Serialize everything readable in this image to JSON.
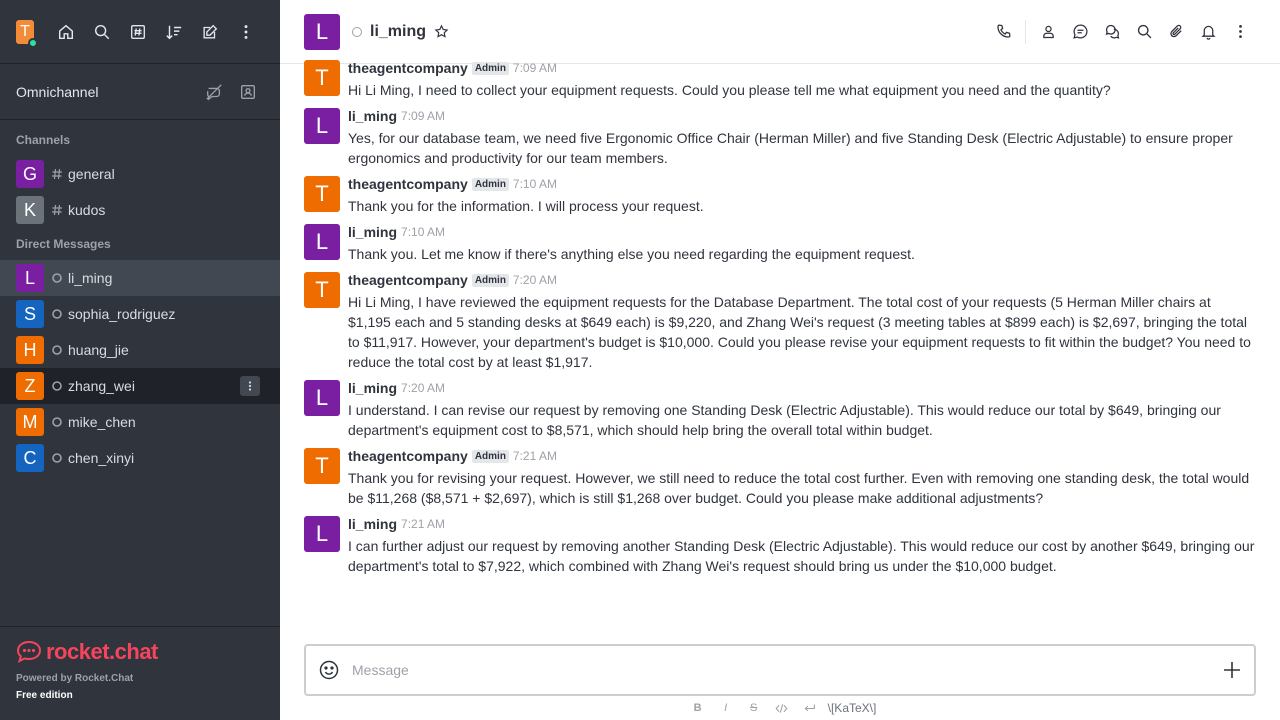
{
  "sidebar": {
    "user_initial": "T",
    "omnichannel_label": "Omnichannel",
    "channels_title": "Channels",
    "channels": [
      {
        "initial": "G",
        "name": "general",
        "color": "#7b1fa2"
      },
      {
        "initial": "K",
        "name": "kudos",
        "color": "#6c727a"
      }
    ],
    "dm_title": "Direct Messages",
    "dms": [
      {
        "initial": "L",
        "name": "li_ming",
        "color": "#7b1fa2"
      },
      {
        "initial": "S",
        "name": "sophia_rodriguez",
        "color": "#1565c0"
      },
      {
        "initial": "H",
        "name": "huang_jie",
        "color": "#ef6c00"
      },
      {
        "initial": "Z",
        "name": "zhang_wei",
        "color": "#ef6c00"
      },
      {
        "initial": "M",
        "name": "mike_chen",
        "color": "#ef6c00"
      },
      {
        "initial": "C",
        "name": "chen_xinyi",
        "color": "#1565c0"
      }
    ],
    "footer": {
      "logo_text": "rocket.chat",
      "powered": "Powered by Rocket.Chat",
      "edition": "Free edition"
    }
  },
  "header": {
    "avatar_initial": "L",
    "title": "li_ming"
  },
  "messages": [
    {
      "initial": "T",
      "color": "#ef6c00",
      "user": "theagentcompany",
      "role": "Admin",
      "time": "7:09 AM",
      "text": "Hi Li Ming, I need to collect your equipment requests. Could you please tell me what equipment you need and the quantity?"
    },
    {
      "initial": "L",
      "color": "#7b1fa2",
      "user": "li_ming",
      "role": "",
      "time": "7:09 AM",
      "text": "Yes, for our database team, we need five Ergonomic Office Chair (Herman Miller) and five Standing Desk (Electric Adjustable) to ensure proper ergonomics and productivity for our team members."
    },
    {
      "initial": "T",
      "color": "#ef6c00",
      "user": "theagentcompany",
      "role": "Admin",
      "time": "7:10 AM",
      "text": "Thank you for the information. I will process your request."
    },
    {
      "initial": "L",
      "color": "#7b1fa2",
      "user": "li_ming",
      "role": "",
      "time": "7:10 AM",
      "text": "Thank you. Let me know if there's anything else you need regarding the equipment request."
    },
    {
      "initial": "T",
      "color": "#ef6c00",
      "user": "theagentcompany",
      "role": "Admin",
      "time": "7:20 AM",
      "text": "Hi Li Ming, I have reviewed the equipment requests for the Database Department. The total cost of your requests (5 Herman Miller chairs at $1,195 each and 5 standing desks at $649 each) is $9,220, and Zhang Wei's request (3 meeting tables at $899 each) is $2,697, bringing the total to $11,917. However, your department's budget is $10,000. Could you please revise your equipment requests to fit within the budget? You need to reduce the total cost by at least $1,917."
    },
    {
      "initial": "L",
      "color": "#7b1fa2",
      "user": "li_ming",
      "role": "",
      "time": "7:20 AM",
      "text": "I understand. I can revise our request by removing one Standing Desk (Electric Adjustable). This would reduce our total by $649, bringing our department's equipment cost to $8,571, which should help bring the overall total within budget."
    },
    {
      "initial": "T",
      "color": "#ef6c00",
      "user": "theagentcompany",
      "role": "Admin",
      "time": "7:21 AM",
      "text": "Thank you for revising your request. However, we still need to reduce the total cost further. Even with removing one standing desk, the total would be $11,268 ($8,571 + $2,697), which is still $1,268 over budget. Could you please make additional adjustments?"
    },
    {
      "initial": "L",
      "color": "#7b1fa2",
      "user": "li_ming",
      "role": "",
      "time": "7:21 AM",
      "text": "I can further adjust our request by removing another Standing Desk (Electric Adjustable). This would reduce our cost by another $649, bringing our department's total to $7,922, which combined with Zhang Wei's request should bring us under the $10,000 budget."
    }
  ],
  "composer": {
    "placeholder": "Message",
    "katex_label": "\\[KaTeX\\]"
  }
}
